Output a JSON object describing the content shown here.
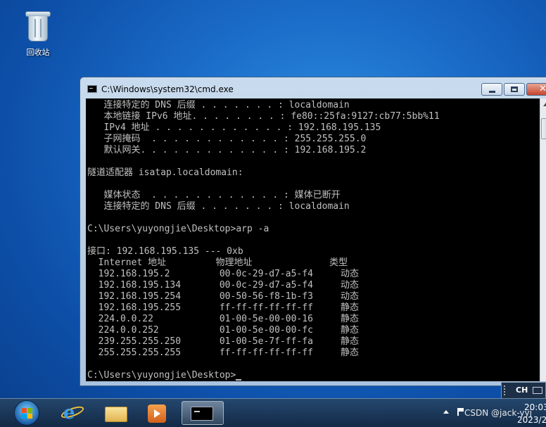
{
  "desktop": {
    "recycle_bin_label": "回收站"
  },
  "window": {
    "title": "C:\\Windows\\system32\\cmd.exe",
    "controls": {
      "minimize": "minimize-icon",
      "maximize": "maximize-icon",
      "close": "close-icon"
    }
  },
  "console": {
    "lines": [
      "   连接特定的 DNS 后缀 . . . . . . . : localdomain",
      "   本地链接 IPv6 地址. . . . . . . . : fe80::25fa:9127:cb77:5bb%11",
      "   IPv4 地址 . . . . . . . . . . . . : 192.168.195.135",
      "   子网掩码  . . . . . . . . . . . . : 255.255.255.0",
      "   默认网关. . . . . . . . . . . . . : 192.168.195.2",
      "",
      "隧道适配器 isatap.localdomain:",
      "",
      "   媒体状态  . . . . . . . . . . . . : 媒体已断开",
      "   连接特定的 DNS 后缀 . . . . . . . : localdomain",
      "",
      "C:\\Users\\yuyongjie\\Desktop>arp -a",
      "",
      "接口: 192.168.195.135 --- 0xb",
      "  Internet 地址         物理地址              类型",
      "  192.168.195.2         00-0c-29-d7-a5-f4     动态",
      "  192.168.195.134       00-0c-29-d7-a5-f4     动态",
      "  192.168.195.254       00-50-56-f8-1b-f3     动态",
      "  192.168.195.255       ff-ff-ff-ff-ff-ff     静态",
      "  224.0.0.22            01-00-5e-00-00-16     静态",
      "  224.0.0.252           01-00-5e-00-00-fc     静态",
      "  239.255.255.250       01-00-5e-7f-ff-fa     静态",
      "  255.255.255.255       ff-ff-ff-ff-ff-ff     静态",
      "",
      "C:\\Users\\yuyongjie\\Desktop>"
    ]
  },
  "taskbar": {
    "pinned": [
      "start-orb",
      "internet-explorer-icon",
      "windows-explorer-icon",
      "media-player-icon",
      "cmd-icon"
    ],
    "language": "CH",
    "watermark": "CSDN @jack-yyj",
    "clock_time": "20:03",
    "clock_date": "2023/2"
  }
}
